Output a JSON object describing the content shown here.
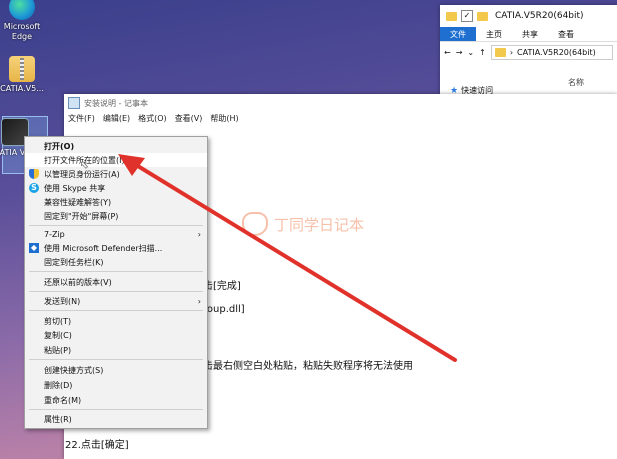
{
  "desktop": {
    "icons": [
      {
        "label": "Microsoft Edge"
      },
      {
        "label": "CATIA.V5..."
      },
      {
        "label": "CATIA V5R"
      }
    ]
  },
  "explorer": {
    "title": "CATIA.V5R20(64bit)",
    "ribbon_tabs": [
      "文件",
      "主页",
      "共享",
      "查看"
    ],
    "address": "CATIA.V5R20(64bit)",
    "column_header": "名称",
    "nav_item": "快速访问"
  },
  "notepad": {
    "title": "安装说明 - 记事本",
    "menu": [
      "文件(F)",
      "编辑(E)",
      "格式(O)",
      "查看(V)",
      "帮助(H)"
    ],
    "lines": [
      "击[完成]",
      "roup.dll]",
      "击最右侧空白处粘贴，粘贴失败程序将无法使用",
      "22.点击[确定]"
    ],
    "watermark": "丁同学日记本"
  },
  "context_menu": {
    "items": [
      {
        "label": "打开(O)"
      },
      {
        "label": "打开文件所在的位置(I)"
      },
      {
        "label": "以管理员身份运行(A)"
      },
      {
        "label": "使用 Skype 共享"
      },
      {
        "label": "兼容性疑难解答(Y)"
      },
      {
        "label": "固定到\"开始\"屏幕(P)"
      },
      {
        "label": "7-Zip"
      },
      {
        "label": "使用 Microsoft Defender扫描..."
      },
      {
        "label": "固定到任务栏(K)"
      },
      {
        "label": "还原以前的版本(V)"
      },
      {
        "label": "发送到(N)"
      },
      {
        "label": "剪切(T)"
      },
      {
        "label": "复制(C)"
      },
      {
        "label": "粘贴(P)"
      },
      {
        "label": "创建快捷方式(S)"
      },
      {
        "label": "删除(D)"
      },
      {
        "label": "重命名(M)"
      },
      {
        "label": "属性(R)"
      }
    ]
  },
  "colors": {
    "annotation_arrow": "#e0322a",
    "accent": "#1e6fcf"
  }
}
